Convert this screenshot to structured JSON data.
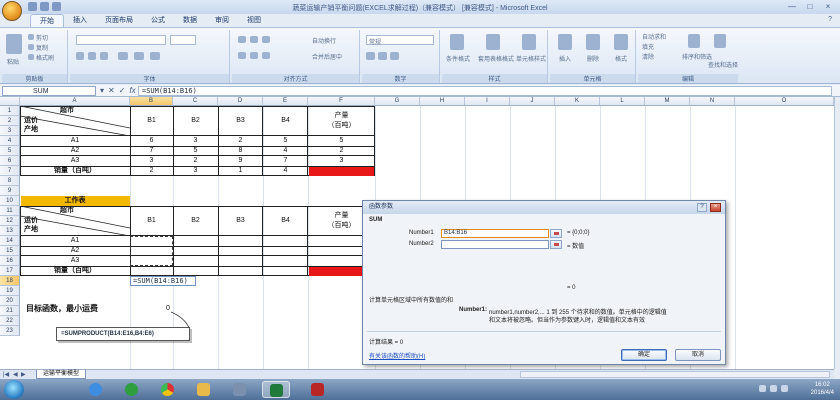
{
  "window": {
    "title": "蔬菜运输产销平衡问题(EXCEL求解过程)（兼容模式） [兼容模式] - Microsoft Excel",
    "controls": [
      "—",
      "□",
      "×"
    ]
  },
  "ribbon": {
    "tabs": [
      "开始",
      "插入",
      "页面布局",
      "公式",
      "数据",
      "审阅",
      "视图"
    ],
    "active_tab": "开始",
    "groups": [
      {
        "label": "剪贴板",
        "items": [
          "粘贴",
          "剪切",
          "复制",
          "格式刷"
        ]
      },
      {
        "label": "字体",
        "items": []
      },
      {
        "label": "对齐方式",
        "items": [
          "自动换行",
          "合并后居中"
        ]
      },
      {
        "label": "数字",
        "items": [
          "常规"
        ]
      },
      {
        "label": "样式",
        "items": [
          "条件格式",
          "套用表格格式",
          "单元格样式"
        ]
      },
      {
        "label": "单元格",
        "items": [
          "插入",
          "删除",
          "格式"
        ]
      },
      {
        "label": "编辑",
        "items": [
          "自动求和",
          "填充",
          "清除",
          "排序和筛选",
          "查找和选择"
        ]
      }
    ]
  },
  "formula_bar": {
    "name_box": "SUM",
    "icons": [
      "▾",
      "✕",
      "✓",
      "fx"
    ],
    "formula": "=SUM(B14:B16)"
  },
  "sheet": {
    "columns": [
      "A",
      "B",
      "C",
      "D",
      "E",
      "F",
      "G",
      "H",
      "I",
      "J",
      "K",
      "L",
      "M",
      "N",
      "O"
    ],
    "selected_column": "B",
    "rows": [
      "1",
      "2",
      "3",
      "4",
      "5",
      "6",
      "7",
      "8",
      "9",
      "10",
      "11",
      "12",
      "13",
      "14",
      "15",
      "16",
      "17",
      "18",
      "19",
      "20",
      "21",
      "22",
      "23"
    ],
    "selected_row": "18",
    "table1": {
      "corner_top": "超市",
      "corner_mid": "运价",
      "corner_bot": "产地",
      "headers": [
        "B1",
        "B2",
        "B3",
        "B4"
      ],
      "output_header": [
        "产量",
        "（百吨）"
      ],
      "rows": [
        {
          "label": "A1",
          "values": [
            "6",
            "3",
            "2",
            "5"
          ],
          "output": "5"
        },
        {
          "label": "A2",
          "values": [
            "7",
            "5",
            "8",
            "4"
          ],
          "output": "2"
        },
        {
          "label": "A3",
          "values": [
            "3",
            "2",
            "9",
            "7"
          ],
          "output": "3"
        }
      ],
      "sales_label": "销量（百吨）",
      "sales": [
        "2",
        "3",
        "1",
        "4"
      ]
    },
    "table2": {
      "title": "工作表",
      "corner_top": "超市",
      "corner_mid": "运价",
      "corner_bot": "产地",
      "headers": [
        "B1",
        "B2",
        "B3",
        "B4"
      ],
      "output_header": [
        "产量",
        "（百吨）"
      ],
      "rows": [
        "A1",
        "A2",
        "A3"
      ],
      "sales_label": "销量（百吨）"
    },
    "editing_cell": "=SUM(B14:B16)",
    "objective_label": "目标函数，最小运费",
    "objective_value": "0",
    "tooltip_formula": "=SUMPRODUCT(B14:E16,B4:E6)",
    "sheet_tab": "运输平衡模型",
    "colors": {
      "accent_red": "#e81818",
      "header_yellow": "#f5b800"
    }
  },
  "dialog": {
    "title": "函数参数",
    "function_name": "SUM",
    "arg1_label": "Number1",
    "arg1_value": "B14:B16",
    "arg1_result": "= {0;0;0}",
    "arg2_label": "Number2",
    "arg2_value": "",
    "arg2_result": "= 数值",
    "result_eq": "= 0",
    "description": "计算单元格区域中所有数值的和",
    "arg_help_label": "Number1:",
    "arg_help_text_1": "number1,number2,...   1 到 255 个待求和的数值。单元格中的逻辑值",
    "arg_help_text_2": "和文本将被忽略。但当作为参数键入时，逻辑值和文本有效",
    "calc_result": "计算结果 = 0",
    "help_link": "有关该函数的帮助(H)",
    "ok_label": "确定",
    "cancel_label": "取消",
    "help_btn": "?",
    "close_btn": "×"
  },
  "taskbar": {
    "clock_time": "16:02",
    "clock_date": "2016/4/4"
  }
}
